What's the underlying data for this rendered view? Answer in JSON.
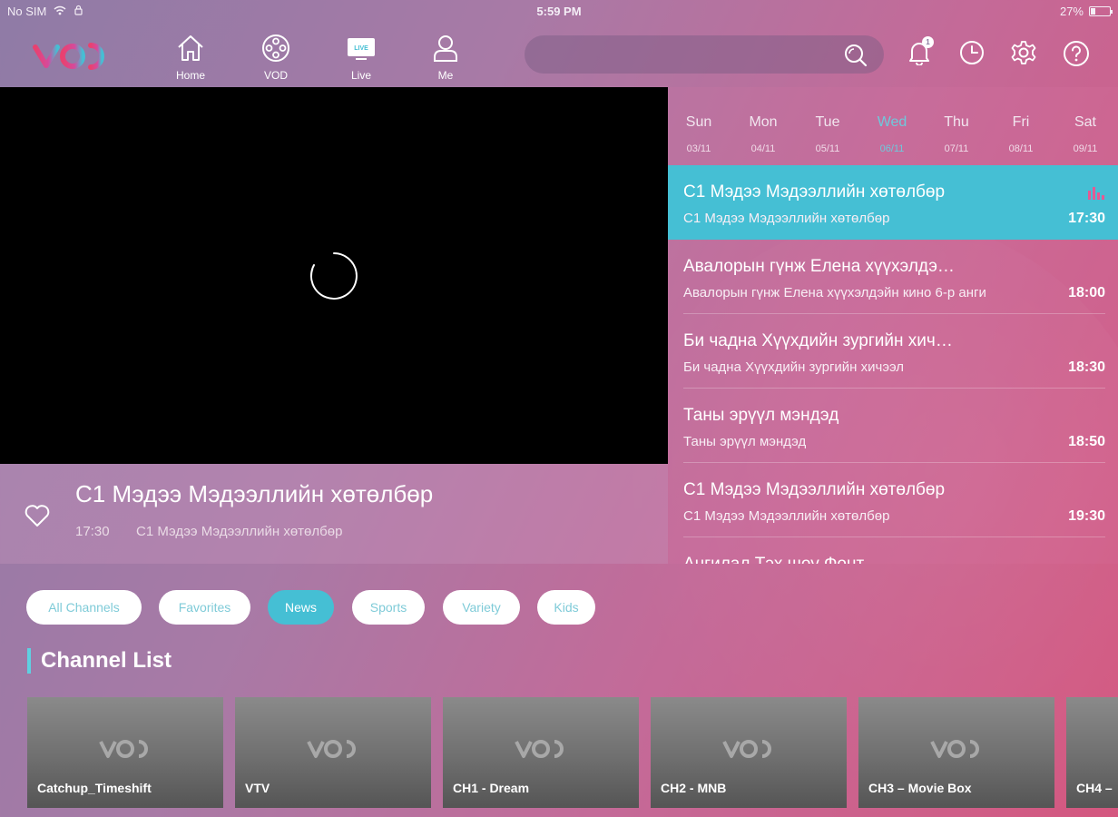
{
  "status_bar": {
    "carrier": "No SIM",
    "time": "5:59 PM",
    "battery": "27%",
    "battery_level": 0.27
  },
  "brand": {
    "logo_text": "VOD",
    "accent": "#45bfd4",
    "logo_colors": [
      "#e9416f",
      "#45bfd4"
    ]
  },
  "nav": {
    "items": [
      {
        "label": "Home",
        "icon": "home-icon"
      },
      {
        "label": "VOD",
        "icon": "film-reel-icon"
      },
      {
        "label": "Live",
        "icon": "live-tv-icon",
        "badge": "LIVE"
      },
      {
        "label": "Me",
        "icon": "user-icon"
      }
    ],
    "search_placeholder": "",
    "notification_count": "1"
  },
  "player": {
    "state": "loading"
  },
  "now_playing": {
    "title": "C1 Мэдээ Мэдээллийн хөтөлбөр",
    "time": "17:30",
    "description": "C1 Мэдээ Мэдээллийн хөтөлбөр"
  },
  "epg": {
    "days": [
      {
        "name": "Sun",
        "date": "03/11",
        "active": false
      },
      {
        "name": "Mon",
        "date": "04/11",
        "active": false
      },
      {
        "name": "Tue",
        "date": "05/11",
        "active": false
      },
      {
        "name": "Wed",
        "date": "06/11",
        "active": true
      },
      {
        "name": "Thu",
        "date": "07/11",
        "active": false
      },
      {
        "name": "Fri",
        "date": "08/11",
        "active": false
      },
      {
        "name": "Sat",
        "date": "09/11",
        "active": false
      }
    ],
    "programs": [
      {
        "title": "C1 Мэдээ Мэдээллийн хөтөлбөр",
        "subtitle": "C1 Мэдээ Мэдээллийн хөтөлбөр",
        "time": "17:30",
        "active": true
      },
      {
        "title": "Авалорын гүнж Елена хүүхэлдэйн кино",
        "subtitle": "Авалорын гүнж Елена хүүхэлдэйн кино 6-р анги",
        "time": "18:00",
        "active": false
      },
      {
        "title": "Би чадна Хүүхдийн зургийн хичээл",
        "subtitle": "Би чадна Хүүхдийн зургийн хичээл",
        "time": "18:30",
        "active": false
      },
      {
        "title": "Таны эрүүл мэндэд",
        "subtitle": "Таны эрүүл мэндэд",
        "time": "18:50",
        "active": false
      },
      {
        "title": "C1 Мэдээ Мэдээллийн хөтөлбөр",
        "subtitle": "C1 Мэдээ Мэдээллийн хөтөлбөр",
        "time": "19:30",
        "active": false
      },
      {
        "title": "Ангилал Тэх шоу Фонт",
        "subtitle": "",
        "time": "",
        "active": false
      }
    ]
  },
  "filters": [
    {
      "label": "All Channels",
      "active": false
    },
    {
      "label": "Favorites",
      "active": false
    },
    {
      "label": "News",
      "active": true
    },
    {
      "label": "Sports",
      "active": false
    },
    {
      "label": "Variety",
      "active": false
    },
    {
      "label": "Kids",
      "active": false
    }
  ],
  "channel_list": {
    "title": "Channel List",
    "channels": [
      {
        "name": "Catchup_Timeshift"
      },
      {
        "name": "VTV"
      },
      {
        "name": "CH1 - Dream"
      },
      {
        "name": "CH2 - MNB"
      },
      {
        "name": "CH3 – Movie Box"
      },
      {
        "name": "CH4 –"
      }
    ]
  }
}
